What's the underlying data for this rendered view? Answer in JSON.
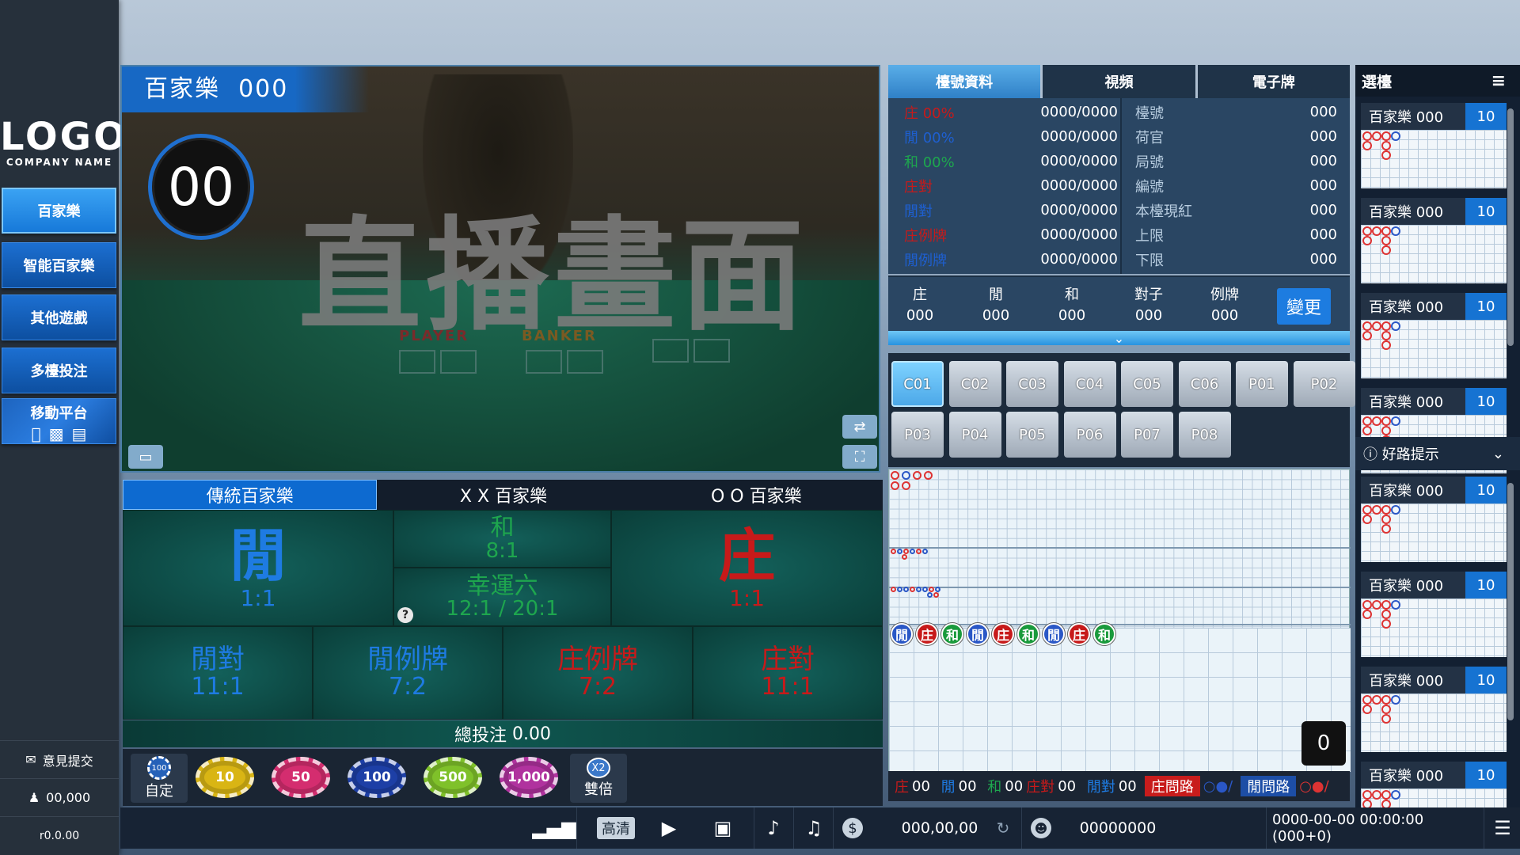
{
  "brand": {
    "logo_text": "LOGO",
    "company_name": "COMPANY NAME"
  },
  "sidebar": {
    "items": [
      {
        "label": "百家樂"
      },
      {
        "label": "智能百家樂"
      },
      {
        "label": "其他遊戲"
      },
      {
        "label": "多檯投注"
      },
      {
        "label": "移動平台"
      }
    ],
    "feedback_label": "意見提交",
    "online_count": "00,000",
    "version": "r0.0.00"
  },
  "video": {
    "title": "百家樂",
    "table_no": "000",
    "countdown": "00",
    "live_placeholder": "直播畫面",
    "felt_player": "PLAYER",
    "felt_banker": "BANKER"
  },
  "bet_tabs": [
    "傳統百家樂",
    "X X 百家樂",
    "O O 百家樂"
  ],
  "bets": {
    "player": {
      "name": "閒",
      "odds": "1:1"
    },
    "tie": {
      "name": "和",
      "odds": "8:1"
    },
    "lucky6": {
      "name": "幸運六",
      "odds": "12:1 / 20:1"
    },
    "banker": {
      "name": "庄",
      "odds": "1:1"
    },
    "player_pair": {
      "name": "閒對",
      "odds": "11:1"
    },
    "player_natural": {
      "name": "閒例牌",
      "odds": "7:2"
    },
    "banker_natural": {
      "name": "庄例牌",
      "odds": "7:2"
    },
    "banker_pair": {
      "name": "庄對",
      "odds": "11:1"
    },
    "total_label": "總投注",
    "total_value": "0.00"
  },
  "chips": {
    "custom_label": "自定",
    "custom_chip": "100",
    "values": [
      "10",
      "50",
      "100",
      "500",
      "1,000"
    ],
    "colors": [
      "#d9b514",
      "#d42d6f",
      "#1d3fa6",
      "#7fc12a",
      "#b0329e"
    ],
    "double_badge": "X2",
    "double_label": "雙倍"
  },
  "info": {
    "tabs": [
      "檯號資料",
      "視頻",
      "電子牌"
    ],
    "stats": [
      {
        "label": "庄 00%",
        "value": "0000/0000",
        "color": "#c71a1a"
      },
      {
        "label": "閒 00%",
        "value": "0000/0000",
        "color": "#1e5fd0"
      },
      {
        "label": "和 00%",
        "value": "0000/0000",
        "color": "#1ea64e"
      },
      {
        "label": "庄對",
        "value": "0000/0000",
        "color": "#c71a1a"
      },
      {
        "label": "閒對",
        "value": "0000/0000",
        "color": "#1e5fd0"
      },
      {
        "label": "庄例牌",
        "value": "0000/0000",
        "color": "#c71a1a"
      },
      {
        "label": "閒例牌",
        "value": "0000/0000",
        "color": "#1e5fd0"
      }
    ],
    "details": [
      {
        "label": "檯號",
        "value": "000"
      },
      {
        "label": "荷官",
        "value": "000"
      },
      {
        "label": "局號",
        "value": "000"
      },
      {
        "label": "編號",
        "value": "000"
      },
      {
        "label": "本檯現紅",
        "value": "000"
      },
      {
        "label": "上限",
        "value": "000"
      },
      {
        "label": "下限",
        "value": "000"
      }
    ],
    "summary": [
      {
        "label": "庄",
        "value": "000"
      },
      {
        "label": "閒",
        "value": "000"
      },
      {
        "label": "和",
        "value": "000"
      },
      {
        "label": "對子",
        "value": "000"
      },
      {
        "label": "例牌",
        "value": "000"
      }
    ],
    "change_label": "變更"
  },
  "tables": [
    "C01",
    "C02",
    "C03",
    "C04",
    "C05",
    "C06",
    "P01",
    "P02",
    "P03",
    "P04",
    "P05",
    "P06",
    "P07",
    "P08"
  ],
  "road": {
    "results": [
      "閒",
      "庄",
      "和",
      "閒",
      "庄",
      "和",
      "閒",
      "庄",
      "和"
    ],
    "reset_label": "0",
    "footer": {
      "banker_label": "庄",
      "banker_count": "00",
      "player_label": "閒",
      "player_count": "00",
      "tie_label": "和",
      "tie_count": "00",
      "banker_pair_label": "庄對",
      "banker_pair_count": "00",
      "player_pair_label": "閒對",
      "player_pair_count": "00",
      "ask_banker": "庄問路",
      "ask_player": "閒問路"
    }
  },
  "right_panel": {
    "title": "選檯",
    "hint_label": "好路提示",
    "tables_top": [
      {
        "name": "百家樂 000",
        "count": "10"
      },
      {
        "name": "百家樂 000",
        "count": "10"
      },
      {
        "name": "百家樂 000",
        "count": "10"
      },
      {
        "name": "百家樂 000",
        "count": "10"
      }
    ],
    "tables_bottom": [
      {
        "name": "百家樂 000",
        "count": "10"
      },
      {
        "name": "百家樂 000",
        "count": "10"
      },
      {
        "name": "百家樂 000",
        "count": "10"
      },
      {
        "name": "百家樂 000",
        "count": "10"
      }
    ]
  },
  "bottom_bar": {
    "hd_label": "高清",
    "balance": "000,00,00",
    "username": "00000000",
    "datetime": "0000-00-00 00:00:00 (000+0)"
  },
  "colors": {
    "accent": "#1673d2",
    "banker": "#c71a1a",
    "player": "#1e7be2",
    "tie": "#1ea64e"
  }
}
